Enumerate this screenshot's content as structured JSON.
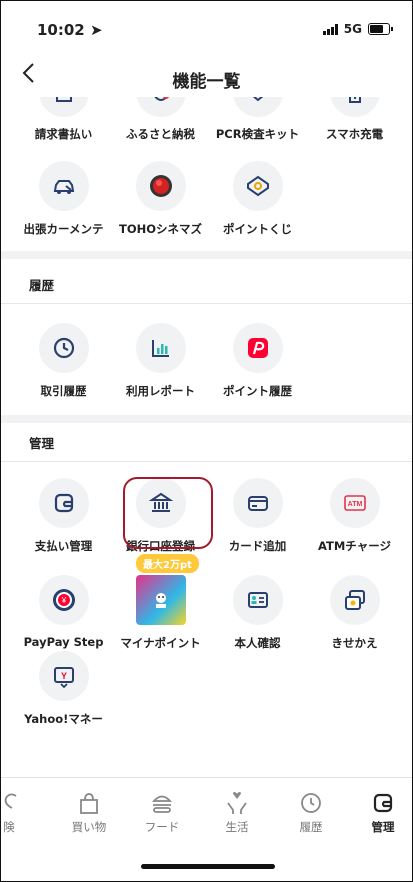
{
  "status": {
    "time": "10:02",
    "network": "5G"
  },
  "nav": {
    "title": "機能一覧"
  },
  "top_partial_labels": [
    "請求書払い",
    "ふるさと納税",
    "PCR検査キット",
    "スマホ充電"
  ],
  "row2_labels": [
    "出張カーメンテ",
    "TOHOシネマズ",
    "ポイントくじ"
  ],
  "history": {
    "title": "履歴",
    "items": [
      "取引履歴",
      "利用レポート",
      "ポイント履歴"
    ]
  },
  "manage": {
    "title": "管理",
    "row1": [
      "支払い管理",
      "銀行口座登録",
      "カード追加",
      "ATMチャージ"
    ],
    "row2": [
      "PayPay Step",
      "マイナポイント",
      "本人確認",
      "きせかえ"
    ],
    "row3": [
      "Yahoo!マネー"
    ],
    "badge": "最大2万pt",
    "atm_icon_text": "ATM"
  },
  "tabs": [
    "険",
    "買い物",
    "フード",
    "生活",
    "履歴",
    "管理"
  ],
  "colors": {
    "accent": "#a5192b",
    "paypay_red": "#ff0033",
    "badge": "#ffc93c",
    "icon_blue": "#2a3f6e"
  }
}
